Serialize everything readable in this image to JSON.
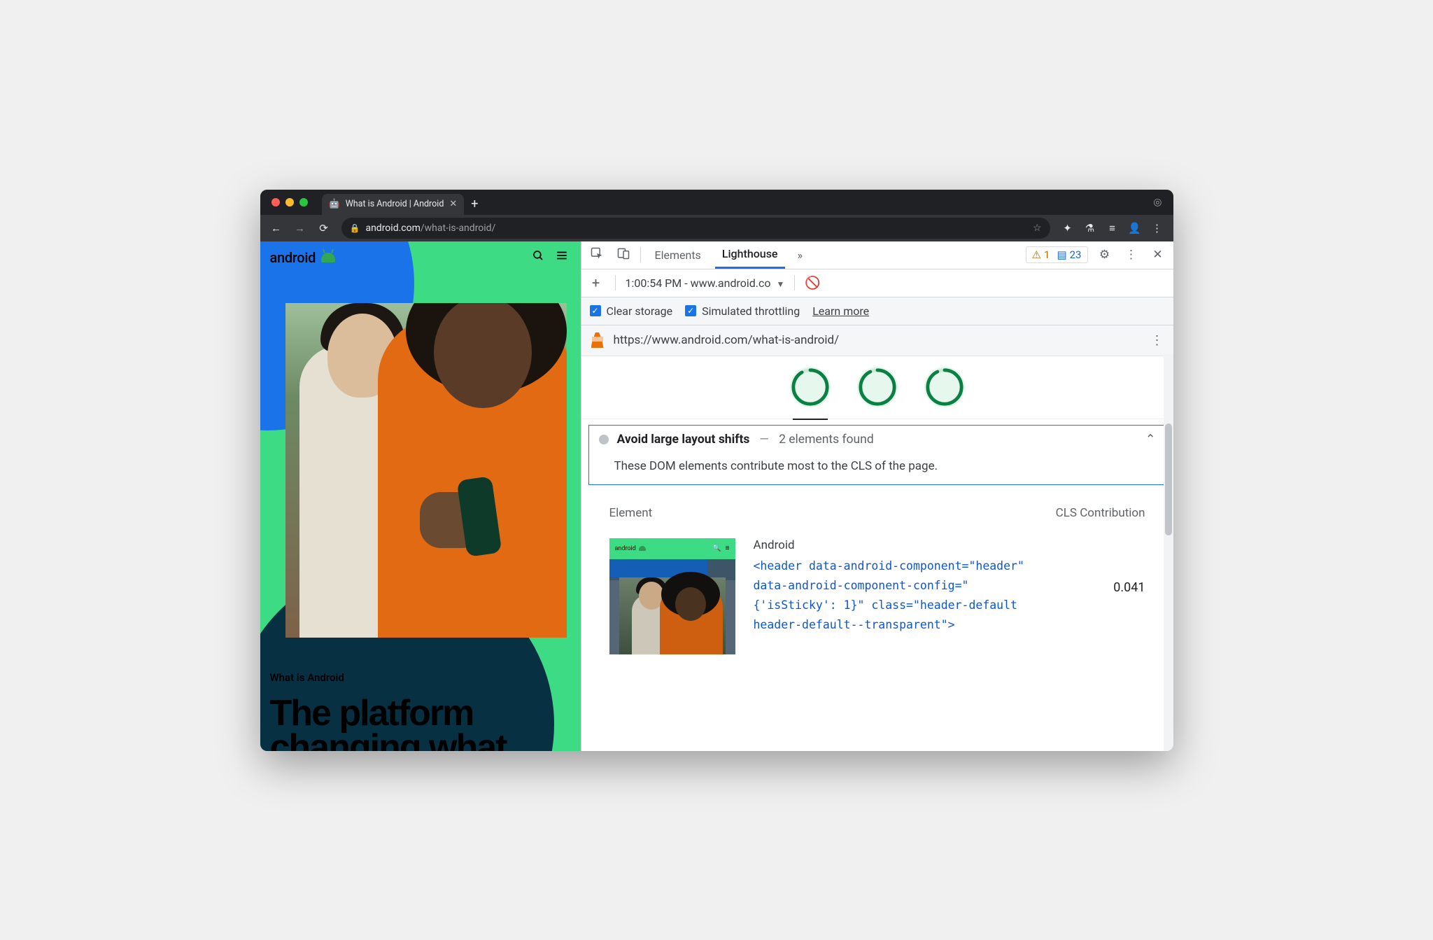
{
  "browser": {
    "tab_title": "What is Android | Android",
    "url_host": "android.com",
    "url_path": "/what-is-android/"
  },
  "page": {
    "brand": "android",
    "eyebrow": "What is Android",
    "heroTitle": "The platform changing what"
  },
  "devtools": {
    "tabs": {
      "elements": "Elements",
      "lighthouse": "Lighthouse"
    },
    "counters": {
      "warnings": "1",
      "messages": "23"
    },
    "runLabel": "1:00:54 PM - www.android.co",
    "options": {
      "clearStorage": "Clear storage",
      "simThrottle": "Simulated throttling",
      "learnMore": "Learn more"
    },
    "auditedUrl": "https://www.android.com/what-is-android/",
    "scores": [
      "92",
      "93",
      "93"
    ],
    "audit": {
      "title": "Avoid large layout shifts",
      "subtitle": "2 elements found",
      "description": "These DOM elements contribute most to the CLS of the page."
    },
    "table": {
      "h1": "Element",
      "h2": "CLS Contribution",
      "row1": {
        "name": "Android",
        "code": "<header data-android-component=\"header\" data-android-component-config=\"{'isSticky': 1}\" class=\"header-default header-default--transparent\">",
        "cls": "0.041",
        "thumbBrand": "android"
      }
    }
  }
}
